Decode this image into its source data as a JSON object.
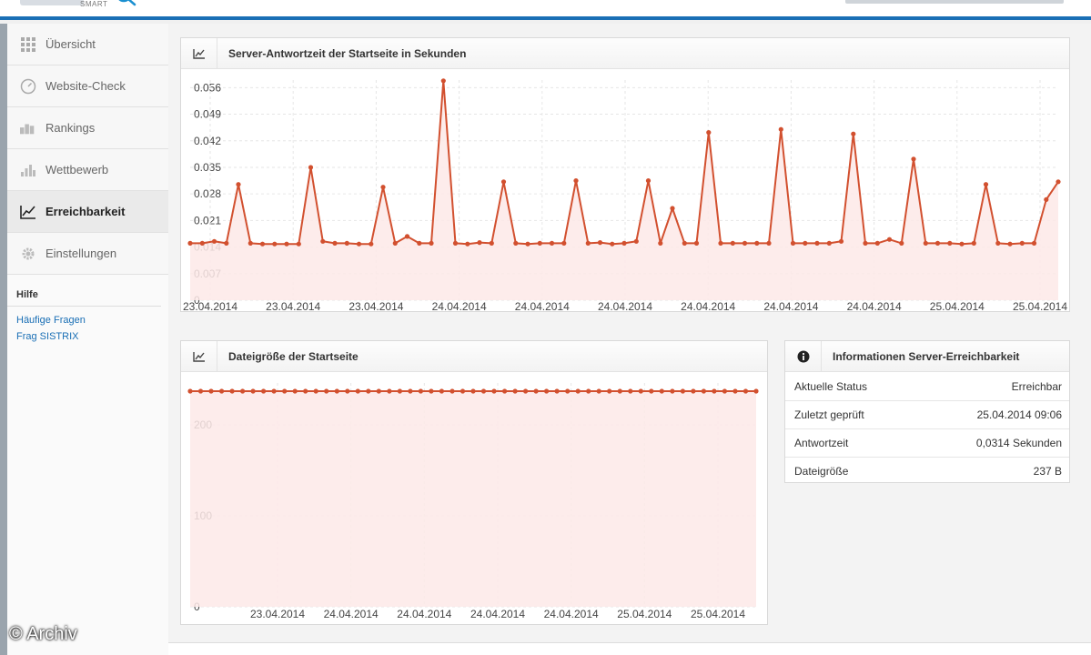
{
  "header": {
    "logo_sub": "SMART"
  },
  "sidebar": {
    "items": [
      {
        "label": "Übersicht",
        "icon": "grid-icon"
      },
      {
        "label": "Website-Check",
        "icon": "gauge-icon"
      },
      {
        "label": "Rankings",
        "icon": "rankings-icon"
      },
      {
        "label": "Wettbewerb",
        "icon": "bar-chart-icon"
      },
      {
        "label": "Erreichbarkeit",
        "icon": "line-chart-icon",
        "active": true
      },
      {
        "label": "Einstellungen",
        "icon": "gear-icon"
      }
    ],
    "help": {
      "title": "Hilfe",
      "links": [
        "Häufige Fragen",
        "Frag SISTRIX"
      ]
    }
  },
  "response_panel": {
    "title": "Server-Antwortzeit der Startseite in Sekunden"
  },
  "size_panel": {
    "title": "Dateigröße der Startseite"
  },
  "info_panel": {
    "title": "Informationen Server-Erreichbarkeit",
    "rows": [
      {
        "label": "Aktuelle Status",
        "value": "Erreichbar"
      },
      {
        "label": "Zuletzt geprüft",
        "value": "25.04.2014 09:06"
      },
      {
        "label": "Antwortzeit",
        "value": "0,0314 Sekunden"
      },
      {
        "label": "Dateigröße",
        "value": "237 B"
      }
    ]
  },
  "watermark": "© Archiv",
  "chart_data": [
    {
      "type": "area",
      "title": "Server-Antwortzeit der Startseite in Sekunden",
      "yticks": [
        "0",
        "0.007",
        "0.014",
        "0.021",
        "0.028",
        "0.035",
        "0.042",
        "0.049",
        "0.056"
      ],
      "ylim": [
        0,
        0.058
      ],
      "xticks": [
        "23.04.2014",
        "23.04.2014",
        "23.04.2014",
        "24.04.2014",
        "24.04.2014",
        "24.04.2014",
        "24.04.2014",
        "24.04.2014",
        "24.04.2014",
        "25.04.2014",
        "25.04.2014"
      ],
      "color": "#d2502f",
      "fill": "#fde9e7",
      "grid": true,
      "values": [
        0.015,
        0.015,
        0.0155,
        0.015,
        0.0305,
        0.015,
        0.0148,
        0.0148,
        0.0148,
        0.0148,
        0.035,
        0.0155,
        0.015,
        0.015,
        0.0148,
        0.0148,
        0.0298,
        0.015,
        0.0168,
        0.015,
        0.015,
        0.0578,
        0.015,
        0.0148,
        0.0152,
        0.015,
        0.0312,
        0.015,
        0.0148,
        0.015,
        0.015,
        0.015,
        0.0315,
        0.015,
        0.0152,
        0.0148,
        0.015,
        0.0155,
        0.0315,
        0.015,
        0.0242,
        0.015,
        0.015,
        0.0442,
        0.015,
        0.015,
        0.015,
        0.015,
        0.015,
        0.045,
        0.015,
        0.015,
        0.015,
        0.015,
        0.0155,
        0.0438,
        0.015,
        0.015,
        0.016,
        0.015,
        0.0372,
        0.015,
        0.015,
        0.015,
        0.0148,
        0.015,
        0.0305,
        0.015,
        0.0148,
        0.015,
        0.015,
        0.0265,
        0.0312
      ]
    },
    {
      "type": "area",
      "title": "Dateigröße der Startseite",
      "yticks": [
        "0",
        "100",
        "200"
      ],
      "ylim": [
        0,
        246
      ],
      "xticks": [
        "23.04.2014",
        "24.04.2014",
        "24.04.2014",
        "24.04.2014",
        "24.04.2014",
        "25.04.2014",
        "25.04.2014"
      ],
      "color": "#d2502f",
      "fill": "#fde9e7",
      "grid": true,
      "values": [
        237,
        237,
        237,
        237,
        237,
        237,
        237,
        237,
        237,
        237,
        237,
        237,
        237,
        237,
        237,
        237,
        237,
        237,
        237,
        237,
        237,
        237,
        237,
        237,
        237,
        237,
        237,
        237,
        237,
        237,
        237,
        237,
        237,
        237,
        237,
        237,
        237,
        237,
        237,
        237,
        237,
        237,
        237,
        237,
        237,
        237,
        237,
        237,
        237,
        237,
        237,
        237,
        237,
        237,
        237
      ]
    }
  ]
}
